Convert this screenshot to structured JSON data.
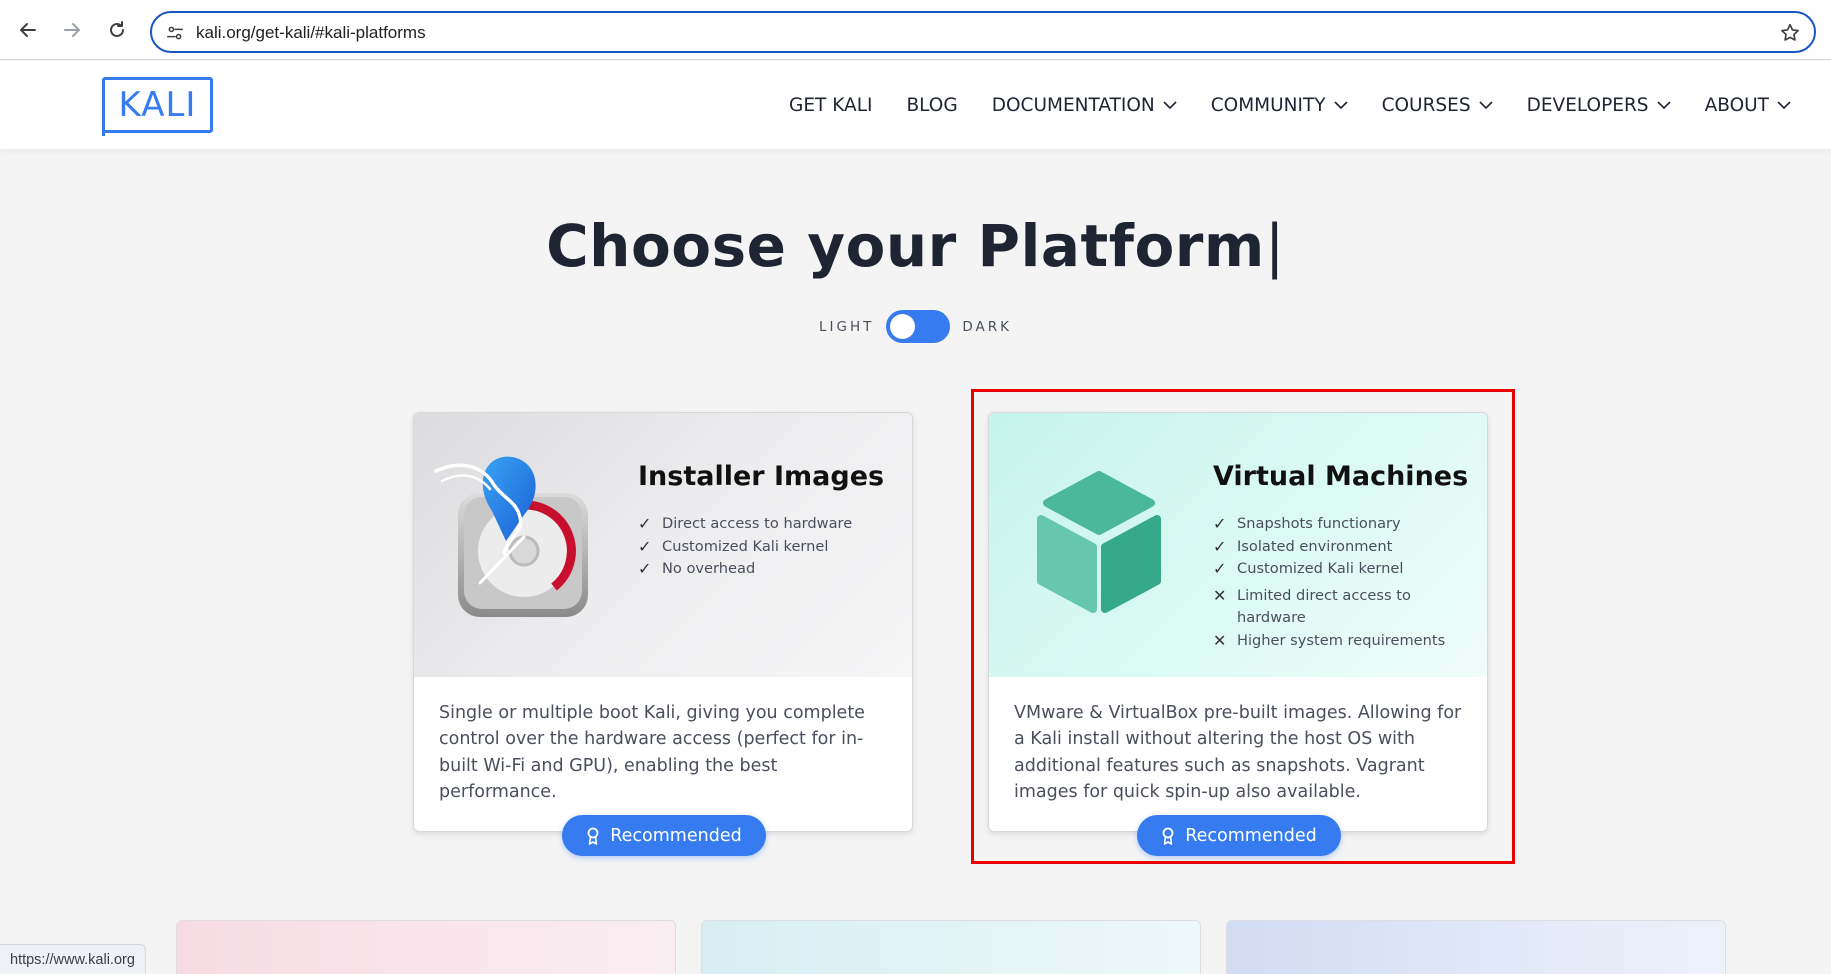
{
  "browser": {
    "url": "kali.org/get-kali/#kali-platforms",
    "status_url": "https://www.kali.org"
  },
  "header": {
    "logo_text": "KALI",
    "menu": [
      {
        "label": "GET KALI",
        "dropdown": false
      },
      {
        "label": "BLOG",
        "dropdown": false
      },
      {
        "label": "DOCUMENTATION",
        "dropdown": true
      },
      {
        "label": "COMMUNITY",
        "dropdown": true
      },
      {
        "label": "COURSES",
        "dropdown": true
      },
      {
        "label": "DEVELOPERS",
        "dropdown": true
      },
      {
        "label": "ABOUT",
        "dropdown": true
      }
    ]
  },
  "hero": {
    "title_pre": "Choose ",
    "title_bold": "your",
    "title_post": " Platform",
    "title_caret": "|",
    "toggle_light": "LIGHT",
    "toggle_dark": "DARK",
    "theme_mode": "light"
  },
  "cards": [
    {
      "title": "Installer Images",
      "features": [
        {
          "mark": "✓",
          "text": "Direct access to hardware"
        },
        {
          "mark": "✓",
          "text": "Customized Kali kernel"
        },
        {
          "mark": "✓",
          "text": "No overhead"
        }
      ],
      "description": "Single or multiple boot Kali, giving you complete control over the hardware access (perfect for in-built Wi-Fi and GPU), enabling the best performance.",
      "button": "Recommended",
      "icon": "installer-disk-icon"
    },
    {
      "title": "Virtual Machines",
      "features": [
        {
          "mark": "✓",
          "text": "Snapshots functionary"
        },
        {
          "mark": "✓",
          "text": "Isolated environment"
        },
        {
          "mark": "✓",
          "text": "Customized Kali kernel"
        },
        {
          "mark": "✕",
          "text": "Limited direct access to hardware"
        },
        {
          "mark": "✕",
          "text": "Higher system requirements"
        }
      ],
      "description": "VMware & VirtualBox pre-built images. Allowing for a Kali install without altering the host OS with additional features such as snapshots. Vagrant images for quick spin-up also available.",
      "button": "Recommended",
      "icon": "virtual-machine-cube-icon"
    }
  ],
  "colors": {
    "accent": "#367bf0",
    "highlight": "#e60000",
    "heading": "#1f2433"
  }
}
